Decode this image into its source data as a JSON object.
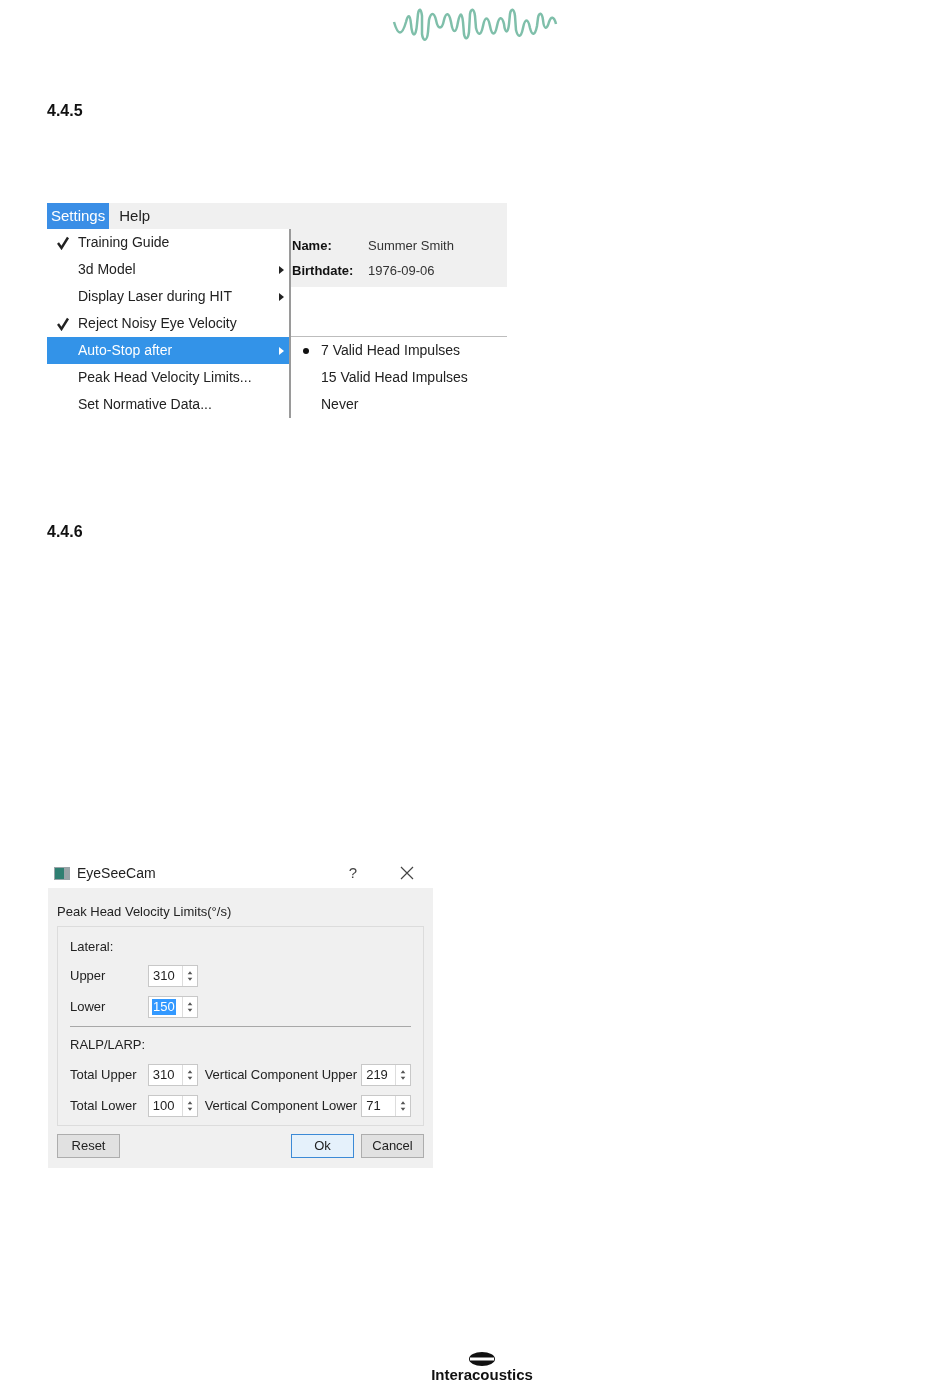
{
  "sections": [
    {
      "number": "4.4.5"
    },
    {
      "number": "4.4.6"
    }
  ],
  "menu_screenshot": {
    "menubar": [
      {
        "label": "Settings",
        "selected": true
      },
      {
        "label": "Help",
        "selected": false
      }
    ],
    "menu_items": [
      {
        "label": "Training Guide",
        "checked": true,
        "submenu": false,
        "selected": false
      },
      {
        "label": "3d Model",
        "checked": false,
        "submenu": true,
        "selected": false
      },
      {
        "label": "Display Laser during HIT",
        "checked": false,
        "submenu": true,
        "selected": false
      },
      {
        "label": "Reject Noisy Eye Velocity",
        "checked": true,
        "submenu": false,
        "selected": false
      },
      {
        "label": "Auto-Stop after",
        "checked": false,
        "submenu": true,
        "selected": true
      },
      {
        "label": "Peak Head Velocity Limits...",
        "checked": false,
        "submenu": false,
        "selected": false
      },
      {
        "label": "Set Normative Data...",
        "checked": false,
        "submenu": false,
        "selected": false
      }
    ],
    "submenu_items": [
      {
        "label": "7 Valid Head Impulses",
        "selected": true
      },
      {
        "label": "15 Valid Head Impulses",
        "selected": false
      },
      {
        "label": "Never",
        "selected": false
      }
    ],
    "patient": [
      {
        "label": "Name:",
        "value": "Summer Smith"
      },
      {
        "label": "Birthdate:",
        "value": "1976-09-06"
      }
    ]
  },
  "dialog": {
    "title": "EyeSeeCam",
    "help": "?",
    "group_title": "Peak Head Velocity Limits(°/s)",
    "lateral": {
      "heading": "Lateral:",
      "fields": [
        {
          "label": "Upper",
          "value": "310",
          "selected": false
        },
        {
          "label": "Lower",
          "value": "150",
          "selected": true
        }
      ]
    },
    "ralp_larp": {
      "heading": "RALP/LARP:",
      "rows": [
        {
          "label": "Total Upper",
          "value": "310",
          "vertical_label": "Vertical Component Upper",
          "vertical_value": "219"
        },
        {
          "label": "Total Lower",
          "value": "100",
          "vertical_label": "Vertical Component Lower",
          "vertical_value": "71"
        }
      ]
    },
    "buttons": [
      {
        "label": "Reset",
        "default": false
      },
      {
        "label": "Ok",
        "default": true
      },
      {
        "label": "Cancel",
        "default": false
      }
    ]
  },
  "footer": {
    "brand": "Interacoustics"
  }
}
